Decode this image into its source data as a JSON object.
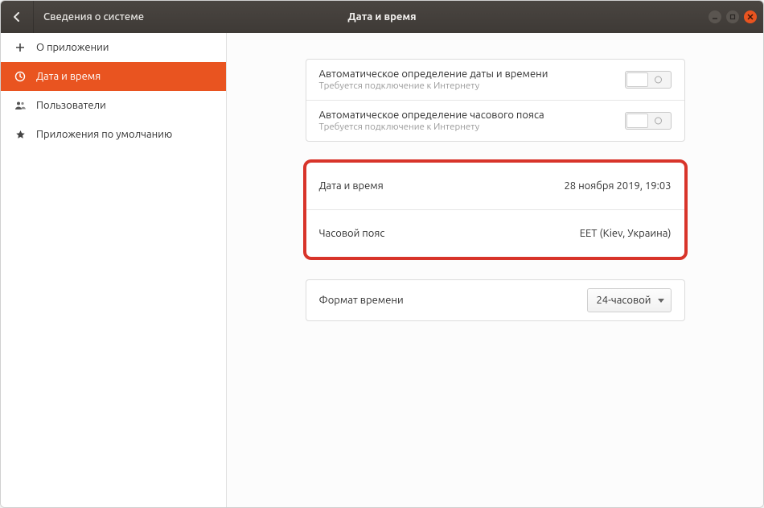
{
  "header": {
    "breadcrumb": "Сведения о системе",
    "title": "Дата и время"
  },
  "sidebar": {
    "items": [
      {
        "label": "О приложении"
      },
      {
        "label": "Дата и время"
      },
      {
        "label": "Пользователи"
      },
      {
        "label": "Приложения по умолчанию"
      }
    ]
  },
  "auto_datetime": {
    "title": "Автоматическое определение даты и времени",
    "subtitle": "Требуется подключение к Интернету"
  },
  "auto_tz": {
    "title": "Автоматическое определение часового пояса",
    "subtitle": "Требуется подключение к Интернету"
  },
  "datetime_row": {
    "label": "Дата и время",
    "value": "28 ноября 2019, 19:03"
  },
  "timezone_row": {
    "label": "Часовой пояс",
    "value": "EET (Kiev, Украина)"
  },
  "time_format": {
    "label": "Формат времени",
    "value": "24-часовой"
  }
}
